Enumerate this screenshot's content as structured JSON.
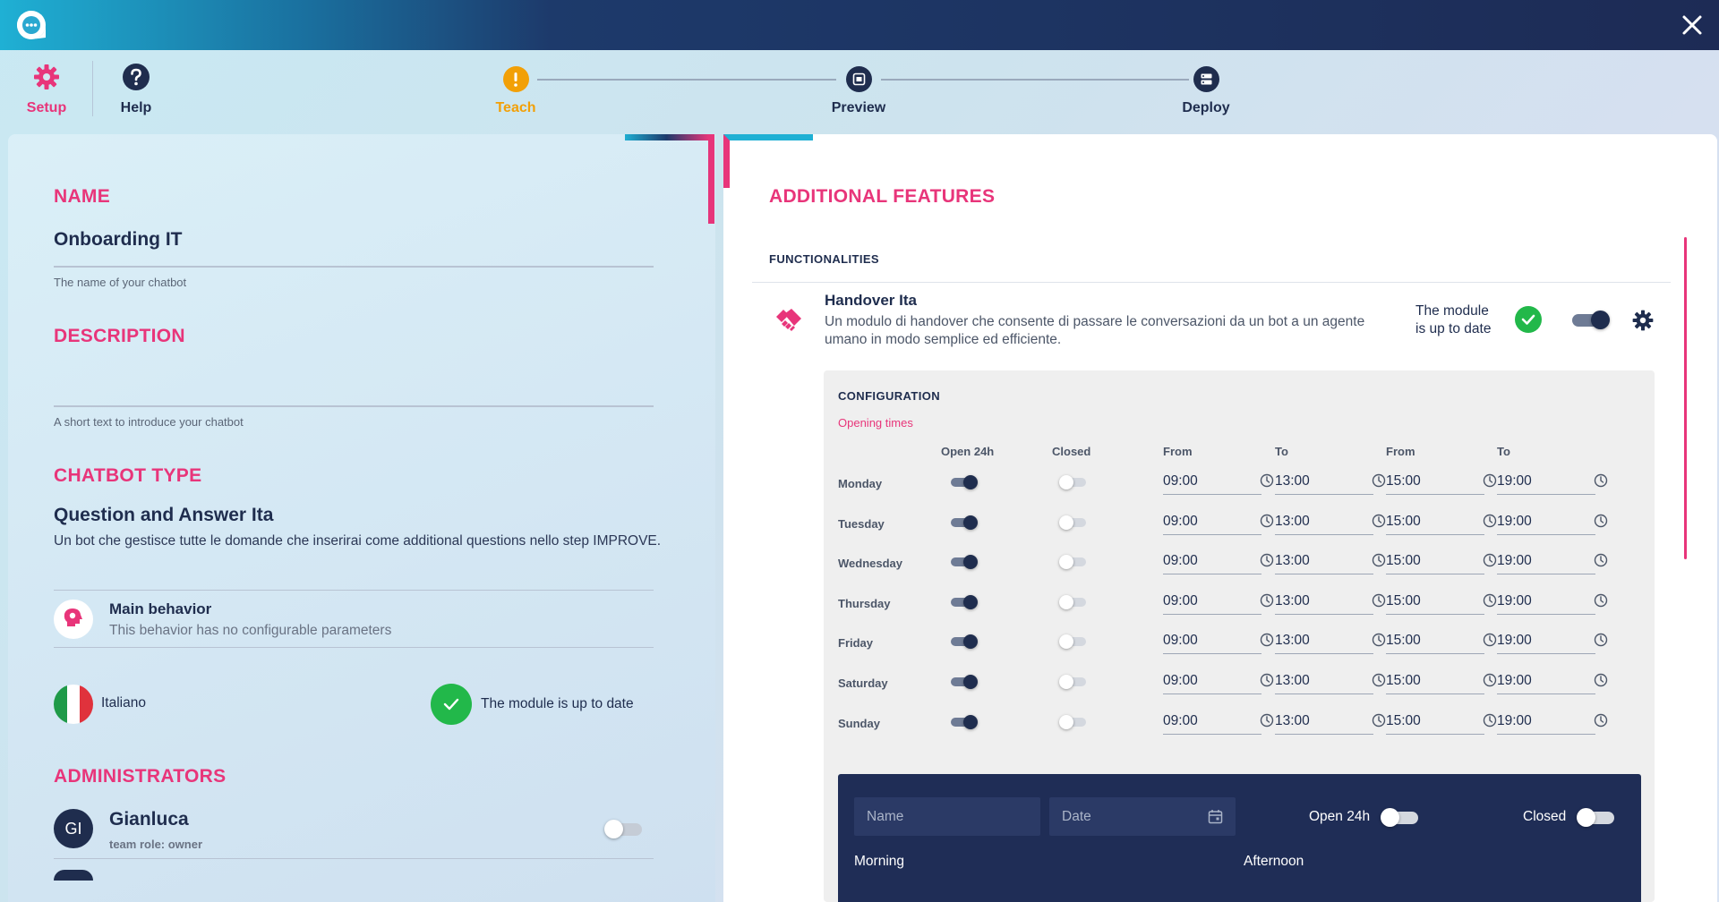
{
  "topnav": {
    "setup": "Setup",
    "help": "Help"
  },
  "steps": [
    {
      "label": "Teach",
      "color": "#f2a007",
      "active": true
    },
    {
      "label": "Preview",
      "color": "#1f2d4e"
    },
    {
      "label": "Deploy",
      "color": "#1f2d4e"
    }
  ],
  "left": {
    "name_title": "NAME",
    "name_value": "Onboarding IT",
    "name_hint": "The name of your chatbot",
    "desc_title": "DESCRIPTION",
    "desc_hint": "A short text to introduce your chatbot",
    "type_title": "CHATBOT TYPE",
    "type_value": "Question and Answer Ita",
    "type_desc": "Un bot che gestisce tutte le domande che inserirai come additional questions nello step IMPROVE.",
    "behavior_title": "Main behavior",
    "behavior_sub": "This behavior has no configurable parameters",
    "language": "Italiano",
    "module_status": "The module is up to date",
    "admin_title": "ADMINISTRATORS",
    "admin_initials": "GI",
    "admin_name": "Gianluca",
    "admin_role": "team role: owner"
  },
  "right": {
    "title": "ADDITIONAL FEATURES",
    "functionalities": "FUNCTIONALITIES",
    "module_name": "Handover Ita",
    "module_desc": "Un modulo di handover che consente di passare le conversazioni da un bot a un agente umano in modo semplice ed efficiente.",
    "module_status_l1": "The module",
    "module_status_l2": "is up to date",
    "configuration": "CONFIGURATION",
    "opening_times": "Opening times",
    "columns": {
      "open24": "Open 24h",
      "closed": "Closed",
      "from1": "From",
      "to1": "To",
      "from2": "From",
      "to2": "To"
    },
    "days": [
      {
        "day": "Monday",
        "open24": true,
        "closed": false,
        "from1": "09:00",
        "to1": "13:00",
        "from2": "15:00",
        "to2": "19:00"
      },
      {
        "day": "Tuesday",
        "open24": true,
        "closed": false,
        "from1": "09:00",
        "to1": "13:00",
        "from2": "15:00",
        "to2": "19:00"
      },
      {
        "day": "Wednesday",
        "open24": true,
        "closed": false,
        "from1": "09:00",
        "to1": "13:00",
        "from2": "15:00",
        "to2": "19:00"
      },
      {
        "day": "Thursday",
        "open24": true,
        "closed": false,
        "from1": "09:00",
        "to1": "13:00",
        "from2": "15:00",
        "to2": "19:00"
      },
      {
        "day": "Friday",
        "open24": true,
        "closed": false,
        "from1": "09:00",
        "to1": "13:00",
        "from2": "15:00",
        "to2": "19:00"
      },
      {
        "day": "Saturday",
        "open24": true,
        "closed": false,
        "from1": "09:00",
        "to1": "13:00",
        "from2": "15:00",
        "to2": "19:00"
      },
      {
        "day": "Sunday",
        "open24": true,
        "closed": false,
        "from1": "09:00",
        "to1": "13:00",
        "from2": "15:00",
        "to2": "19:00"
      }
    ],
    "special": {
      "name_placeholder": "Name",
      "date_placeholder": "Date",
      "open24": "Open 24h",
      "closed": "Closed",
      "morning": "Morning",
      "afternoon": "Afternoon"
    }
  },
  "colors": {
    "accent": "#e8357a",
    "navy": "#1f2d4e",
    "success": "#22b84a"
  }
}
